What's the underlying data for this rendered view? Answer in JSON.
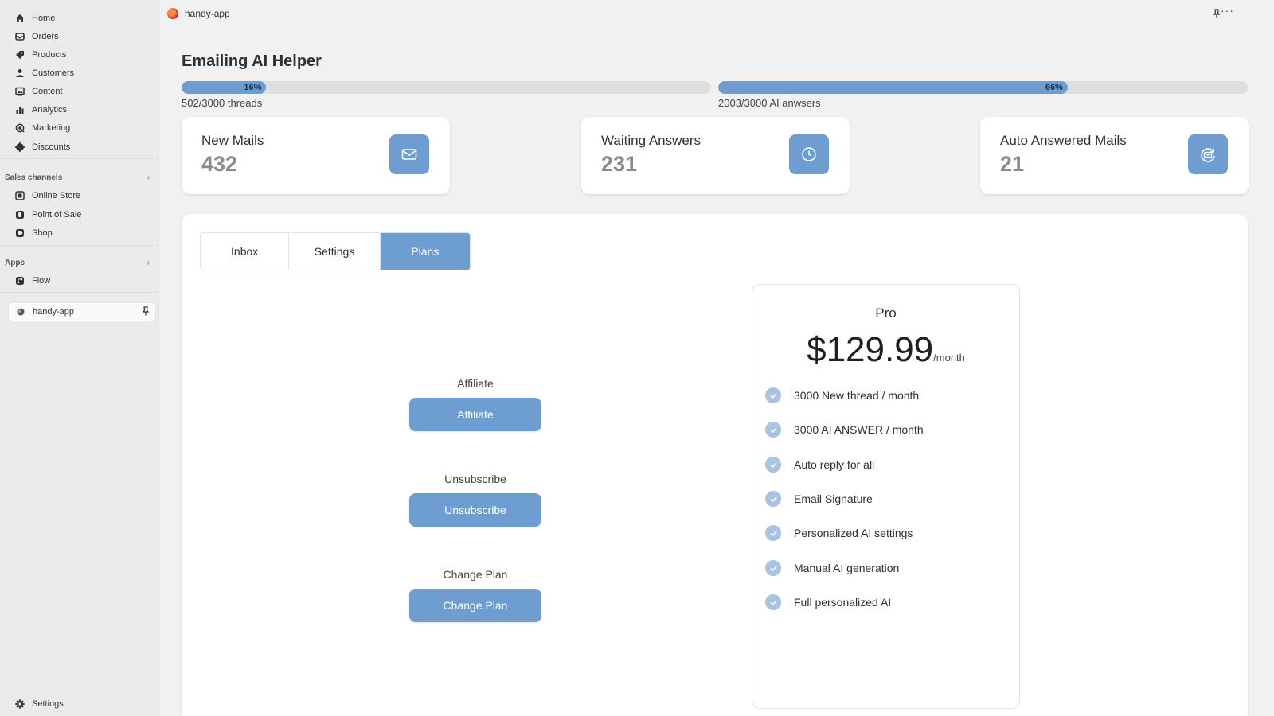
{
  "sidebar": {
    "items": [
      {
        "label": "Home",
        "icon": "home-icon"
      },
      {
        "label": "Orders",
        "icon": "orders-icon"
      },
      {
        "label": "Products",
        "icon": "tag-icon"
      },
      {
        "label": "Customers",
        "icon": "person-icon"
      },
      {
        "label": "Content",
        "icon": "image-icon"
      },
      {
        "label": "Analytics",
        "icon": "bar-chart-icon"
      },
      {
        "label": "Marketing",
        "icon": "target-icon"
      },
      {
        "label": "Discounts",
        "icon": "discount-gear-icon"
      }
    ],
    "sales_channels": {
      "heading": "Sales channels",
      "items": [
        {
          "label": "Online Store",
          "icon": "store-icon"
        },
        {
          "label": "Point of Sale",
          "icon": "pos-icon"
        },
        {
          "label": "Shop",
          "icon": "shop-icon"
        }
      ]
    },
    "apps": {
      "heading": "Apps",
      "items": [
        {
          "label": "Flow",
          "icon": "flow-icon"
        }
      ]
    },
    "active_app": {
      "label": "handy-app",
      "icon": "app-logo-icon"
    },
    "settings_label": "Settings"
  },
  "topbar": {
    "app_name": "handy-app",
    "more_label": "···"
  },
  "page": {
    "title": "Emailing AI Helper"
  },
  "usage": [
    {
      "percent_label": "16%",
      "fraction": 0.16,
      "caption": "502/3000 threads"
    },
    {
      "percent_label": "66%",
      "fraction": 0.66,
      "caption": "2003/3000 AI anwsers"
    }
  ],
  "stats": [
    {
      "title": "New Mails",
      "value": "432",
      "icon": "mail-icon"
    },
    {
      "title": "Waiting Answers",
      "value": "231",
      "icon": "clock-icon"
    },
    {
      "title": "Auto Answered Mails",
      "value": "21",
      "icon": "auto-reply-mail-icon"
    }
  ],
  "tabs": [
    {
      "label": "Inbox",
      "active": false
    },
    {
      "label": "Settings",
      "active": false
    },
    {
      "label": "Plans",
      "active": true
    }
  ],
  "actions": [
    {
      "label": "Affiliate",
      "button": "Affiliate"
    },
    {
      "label": "Unsubscribe",
      "button": "Unsubscribe"
    },
    {
      "label": "Change Plan",
      "button": "Change Plan"
    }
  ],
  "plan": {
    "name": "Pro",
    "price": "$129.99",
    "period": "/month",
    "features": [
      "3000 New thread / month",
      "3000 AI ANSWER / month",
      "Auto reply for all",
      "Email Signature",
      "Personalized AI settings",
      "Manual AI generation",
      "Full personalized AI"
    ]
  },
  "colors": {
    "accent": "#6e9dd1",
    "check": "#a9c3e2",
    "background": "#f1f1f1"
  }
}
